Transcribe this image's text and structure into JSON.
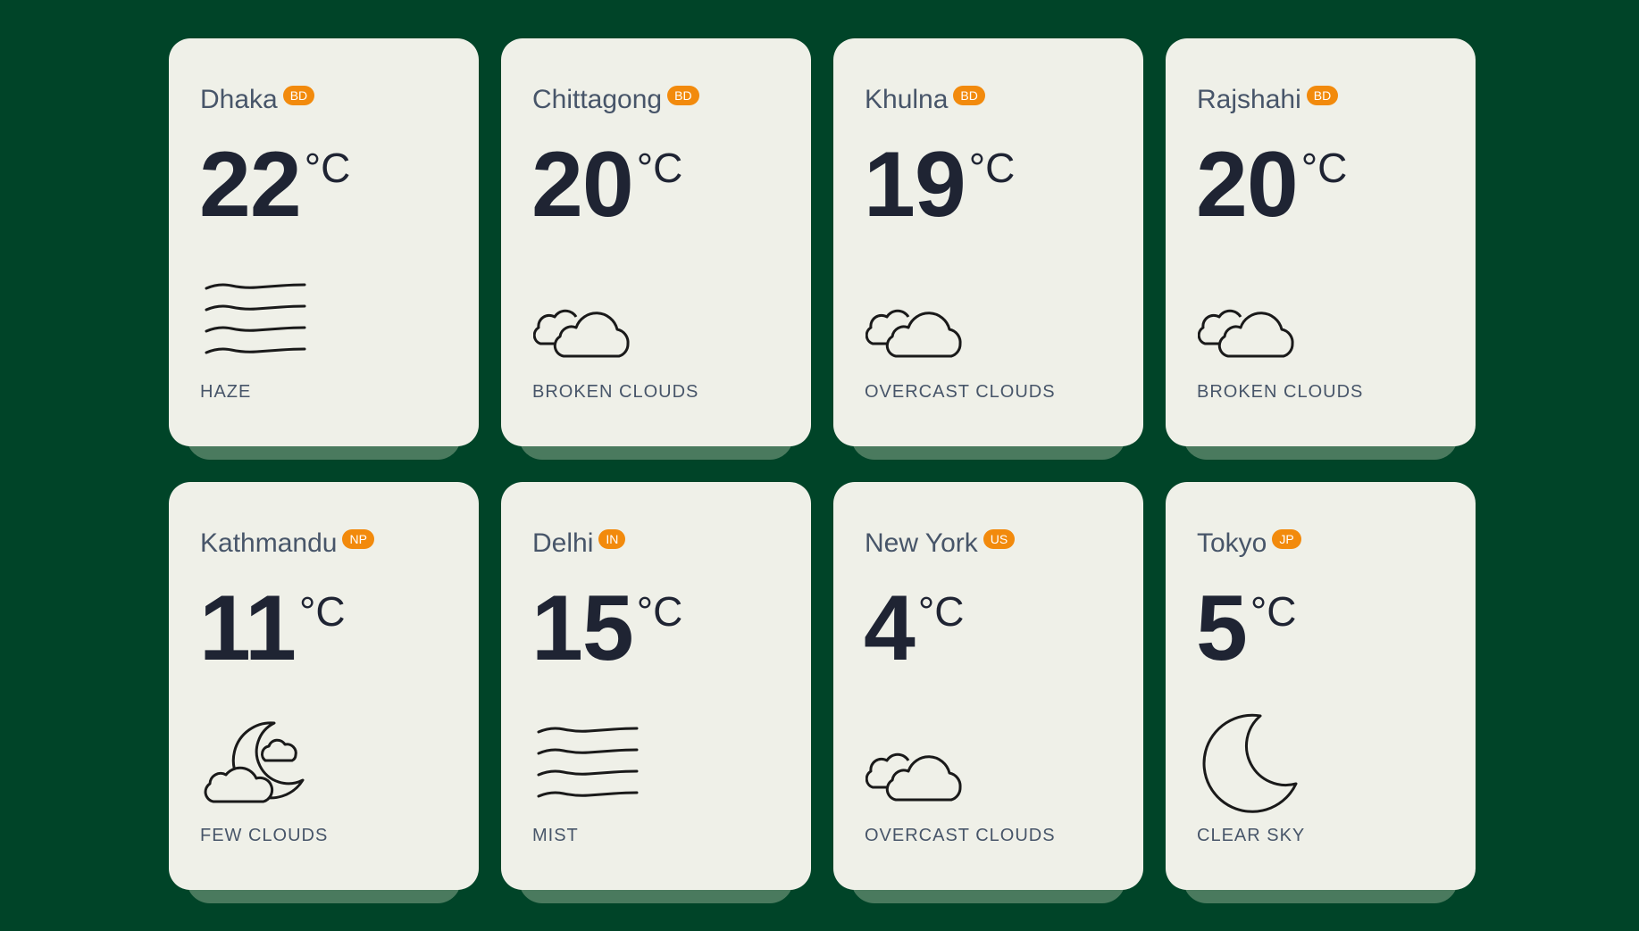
{
  "cards": [
    {
      "city": "Dhaka",
      "country": "BD",
      "temp": "22",
      "unit": "°C",
      "condition": "HAZE",
      "icon": "haze-icon"
    },
    {
      "city": "Chittagong",
      "country": "BD",
      "temp": "20",
      "unit": "°C",
      "condition": "BROKEN CLOUDS",
      "icon": "clouds-icon"
    },
    {
      "city": "Khulna",
      "country": "BD",
      "temp": "19",
      "unit": "°C",
      "condition": "OVERCAST CLOUDS",
      "icon": "clouds-icon"
    },
    {
      "city": "Rajshahi",
      "country": "BD",
      "temp": "20",
      "unit": "°C",
      "condition": "BROKEN CLOUDS",
      "icon": "clouds-icon"
    },
    {
      "city": "Kathmandu",
      "country": "NP",
      "temp": "11",
      "unit": "°C",
      "condition": "FEW CLOUDS",
      "icon": "moon-clouds-icon"
    },
    {
      "city": "Delhi",
      "country": "IN",
      "temp": "15",
      "unit": "°C",
      "condition": "MIST",
      "icon": "mist-icon"
    },
    {
      "city": "New York",
      "country": "US",
      "temp": "4",
      "unit": "°C",
      "condition": "OVERCAST CLOUDS",
      "icon": "clouds-icon"
    },
    {
      "city": "Tokyo",
      "country": "JP",
      "temp": "5",
      "unit": "°C",
      "condition": "CLEAR SKY",
      "icon": "moon-icon"
    }
  ],
  "colors": {
    "background": "#004428",
    "card": "#eff0e8",
    "badge": "#f28a0c",
    "temperature": "#1f2433",
    "label": "#475569"
  }
}
